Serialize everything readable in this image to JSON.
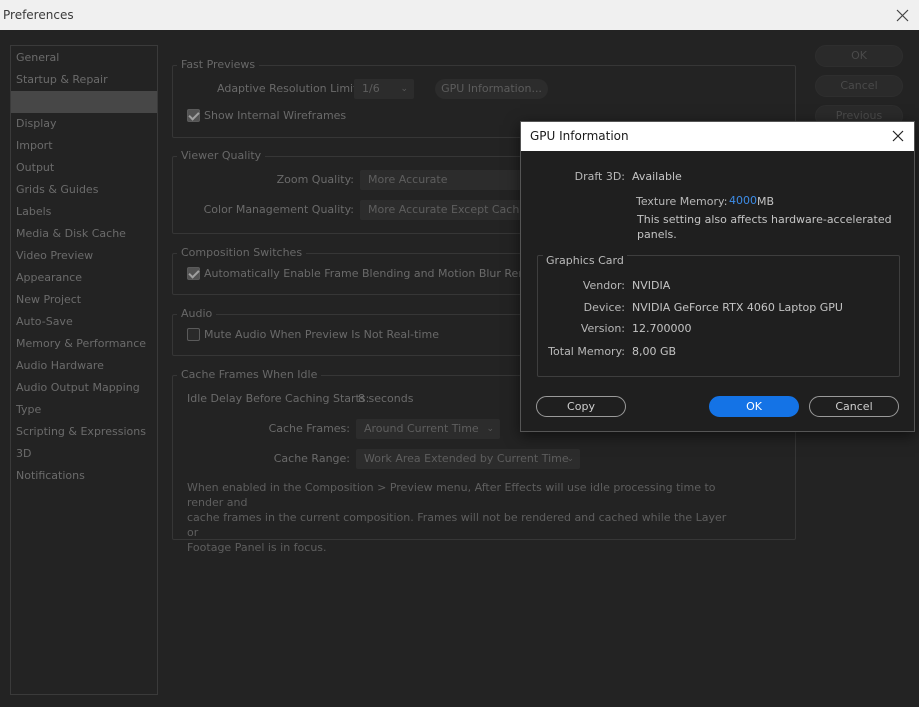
{
  "window": {
    "title": "Preferences"
  },
  "categories": [
    "General",
    "Startup & Repair",
    "",
    "Display",
    "Import",
    "Output",
    "Grids & Guides",
    "Labels",
    "Media & Disk Cache",
    "Video Preview",
    "Appearance",
    "New Project",
    "Auto-Save",
    "Memory & Performance",
    "Audio Hardware",
    "Audio Output Mapping",
    "Type",
    "Scripting & Expressions",
    "3D",
    "Notifications"
  ],
  "side_buttons": {
    "ok": "OK",
    "cancel": "Cancel",
    "previous": "Previous"
  },
  "fast_previews": {
    "title": "Fast Previews",
    "adaptive_label": "Adaptive Resolution Limit:",
    "adaptive_value": "1/6",
    "gpu_info_button": "GPU Information...",
    "wireframes_label": "Show Internal Wireframes",
    "wireframes_checked": true
  },
  "viewer_quality": {
    "title": "Viewer Quality",
    "zoom_label": "Zoom Quality:",
    "zoom_value": "More Accurate",
    "color_label": "Color Management Quality:",
    "color_value": "More Accurate Except Cached P"
  },
  "composition_switches": {
    "title": "Composition Switches",
    "auto_enable_label": "Automatically Enable Frame Blending and Motion Blur Rendering",
    "auto_enable_checked": true
  },
  "audio": {
    "title": "Audio",
    "mute_label": "Mute Audio When Preview Is Not Real-time",
    "mute_checked": false
  },
  "cache_idle": {
    "title": "Cache Frames When Idle",
    "idle_delay_label": "Idle Delay Before Caching Starts:",
    "idle_delay_value": "8 seconds",
    "cache_frames_label": "Cache Frames:",
    "cache_frames_value": "Around Current Time",
    "cache_range_label": "Cache Range:",
    "cache_range_value": "Work Area Extended by Current Time",
    "description_lines": [
      "When enabled in the Composition > Preview menu, After Effects will use idle processing time to render and",
      "cache frames in the current composition. Frames will not be rendered and cached while the Layer or",
      "Footage Panel is in focus."
    ]
  },
  "gpu_dialog": {
    "title": "GPU Information",
    "draft3d_label": "Draft 3D:",
    "draft3d_value": "Available",
    "texture_label": "Texture Memory:",
    "texture_value": "4000",
    "texture_unit": "MB",
    "note_lines": [
      "This setting also affects hardware-accelerated",
      "panels."
    ],
    "graphics_card_title": "Graphics Card",
    "vendor_label": "Vendor:",
    "vendor_value": "NVIDIA",
    "device_label": "Device:",
    "device_value": "NVIDIA GeForce RTX 4060 Laptop GPU",
    "version_label": "Version:",
    "version_value": "12.700000",
    "total_memory_label": "Total Memory:",
    "total_memory_value": "8,00 GB",
    "copy_button": "Copy",
    "ok_button": "OK",
    "cancel_button": "Cancel"
  },
  "colors": {
    "accent": "#1473e6",
    "texture_value": "#3d8ce6"
  }
}
